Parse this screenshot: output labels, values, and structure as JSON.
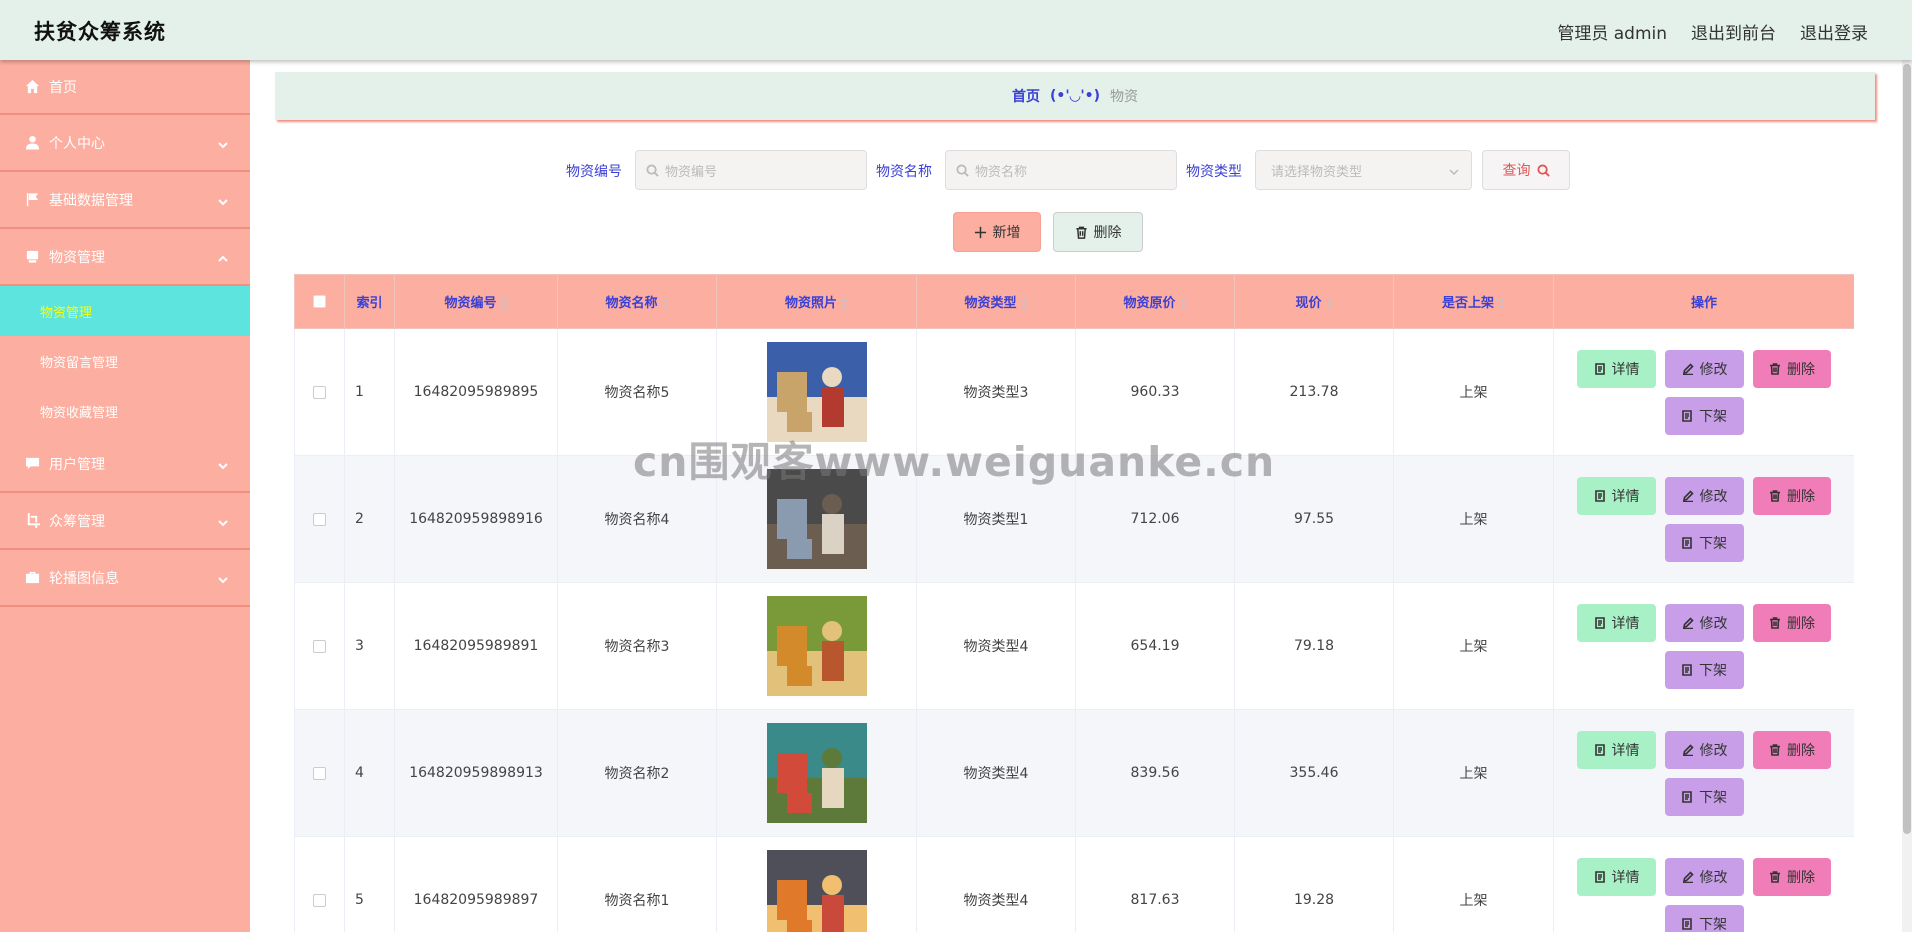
{
  "header": {
    "title": "扶贫众筹系统",
    "user": "管理员 admin",
    "to_front": "退出到前台",
    "logout": "退出登录"
  },
  "sidebar": {
    "items": [
      {
        "label": "首页",
        "icon": "home-icon"
      },
      {
        "label": "个人中心",
        "icon": "user-icon"
      },
      {
        "label": "基础数据管理",
        "icon": "flag-icon"
      },
      {
        "label": "物资管理",
        "icon": "box-icon"
      },
      {
        "label": "用户管理",
        "icon": "chat-icon"
      },
      {
        "label": "众筹管理",
        "icon": "crop-icon"
      },
      {
        "label": "轮播图信息",
        "icon": "briefcase-icon"
      }
    ],
    "submenu": [
      "物资管理",
      "物资留言管理",
      "物资收藏管理"
    ]
  },
  "breadcrumb": {
    "home": "首页",
    "sep": "(•'◡'•)",
    "current": "物资"
  },
  "search": {
    "code_label": "物资编号",
    "code_placeholder": "物资编号",
    "name_label": "物资名称",
    "name_placeholder": "物资名称",
    "type_label": "物资类型",
    "type_placeholder": "请选择物资类型",
    "query": "查询"
  },
  "actions": {
    "add": "新增",
    "delete": "删除"
  },
  "table": {
    "headers": [
      "索引",
      "物资编号",
      "物资名称",
      "物资照片",
      "物资类型",
      "物资原价",
      "现价",
      "是否上架",
      "操作"
    ],
    "rows": [
      {
        "index": "1",
        "code": "16482095989895",
        "name": "物资名称5",
        "type": "物资类型3",
        "orig": "960.33",
        "price": "213.78",
        "status": "上架"
      },
      {
        "index": "2",
        "code": "164820959898916",
        "name": "物资名称4",
        "type": "物资类型1",
        "orig": "712.06",
        "price": "97.55",
        "status": "上架"
      },
      {
        "index": "3",
        "code": "16482095989891",
        "name": "物资名称3",
        "type": "物资类型4",
        "orig": "654.19",
        "price": "79.18",
        "status": "上架"
      },
      {
        "index": "4",
        "code": "164820959898913",
        "name": "物资名称2",
        "type": "物资类型4",
        "orig": "839.56",
        "price": "355.46",
        "status": "上架"
      },
      {
        "index": "5",
        "code": "16482095989897",
        "name": "物资名称1",
        "type": "物资类型4",
        "orig": "817.63",
        "price": "19.28",
        "status": "上架"
      }
    ],
    "ops": {
      "detail": "详情",
      "edit": "修改",
      "remove": "删除",
      "down": "下架"
    }
  },
  "watermark": "cn围观客www.weiguanke.cn",
  "colors": {
    "header_bg": "#e3f1ea",
    "sidebar_bg": "#fcaea0",
    "active_bg": "#5ee4df",
    "active_text": "#ffff00",
    "accent_blue": "#3a3fd6"
  }
}
